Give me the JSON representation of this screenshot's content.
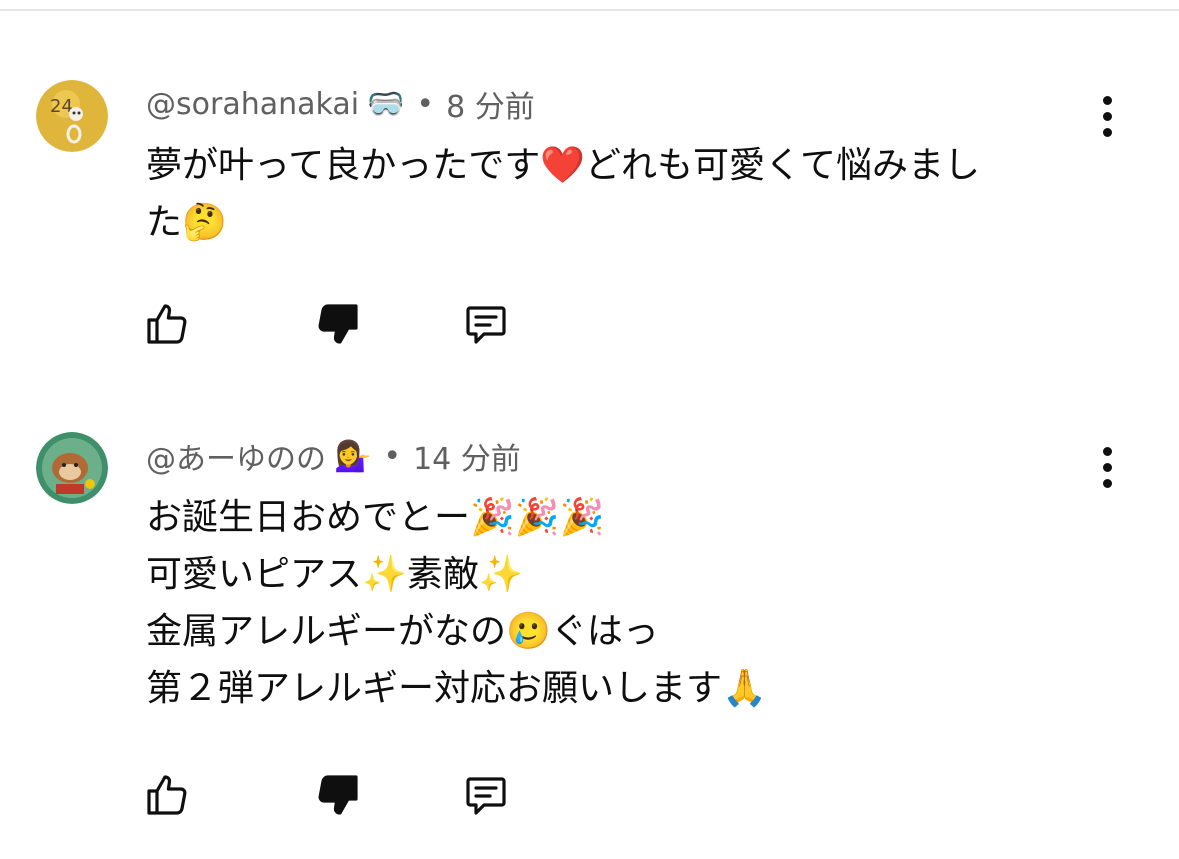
{
  "comments": [
    {
      "handle": "@sorahanakai",
      "handle_badge": "🥽",
      "separator": "•",
      "time": "8 分前",
      "lines": [
        "夢が叶って良かったです❤️どれも可愛くて悩みまし",
        "た🤔"
      ],
      "avatar_colors": [
        "#d9b13a",
        "#f0c84a"
      ]
    },
    {
      "handle": "@あーゆのの",
      "handle_badge": "💁‍♀️",
      "separator": "•",
      "time": "14 分前",
      "lines": [
        "お誕生日おめでとー🎉🎉🎉",
        "可愛いピアス✨素敵✨",
        "金属アレルギーがなの🥲ぐはっ",
        "第２弾アレルギー対応お願いします🙏"
      ],
      "avatar_colors": [
        "#3f8f6a",
        "#9a5a2e"
      ]
    }
  ],
  "icons": {
    "like": "thumbs-up-icon",
    "dislike": "thumbs-down-icon",
    "reply": "reply-comment-icon",
    "more": "more-vertical-icon"
  }
}
